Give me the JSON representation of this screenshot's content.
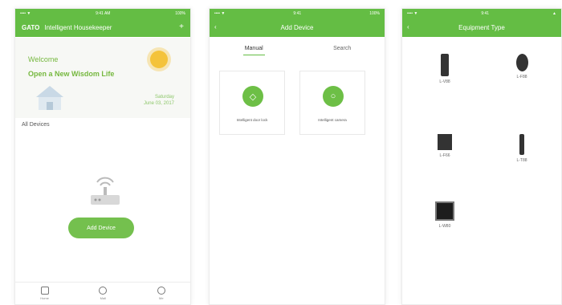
{
  "colors": {
    "accent": "#64bd44",
    "brand": "#74c04e"
  },
  "screen1": {
    "status": {
      "carrier": "•••• ▼",
      "time": "9:41 AM",
      "battery": "100%"
    },
    "title": {
      "brand": "GATO",
      "text": "Intelligent Housekeeper",
      "action_icon": "plus-icon"
    },
    "welcome": {
      "line1": "Welcome",
      "line2": "Open a New Wisdom Life"
    },
    "date": {
      "day": "Saturday",
      "date": "June 03, 2017"
    },
    "section_label": "All Devices",
    "add_button": "Add Device",
    "tabs": [
      {
        "label": "Home",
        "icon": "home-icon"
      },
      {
        "label": "Mall",
        "icon": "mall-icon"
      },
      {
        "label": "Me",
        "icon": "user-icon"
      }
    ]
  },
  "screen2": {
    "status": {
      "carrier": "•••• ▼",
      "time": "9:41",
      "battery": "100%"
    },
    "title": "Add Device",
    "tabs": [
      {
        "label": "Manual"
      },
      {
        "label": "Search"
      }
    ],
    "cards": [
      {
        "label": "Intelligent door lock",
        "icon": "lock-icon"
      },
      {
        "label": "Intelligent camera",
        "icon": "camera-icon"
      }
    ]
  },
  "screen3": {
    "status": {
      "carrier": "•••• ▼",
      "time": "9:41",
      "battery": "▲"
    },
    "title": "Equipment Type",
    "locks": [
      {
        "model": "L-V88"
      },
      {
        "model": "L-F88"
      },
      {
        "model": "L-F66"
      },
      {
        "model": "L-T88"
      },
      {
        "model": "L-W80"
      }
    ]
  }
}
